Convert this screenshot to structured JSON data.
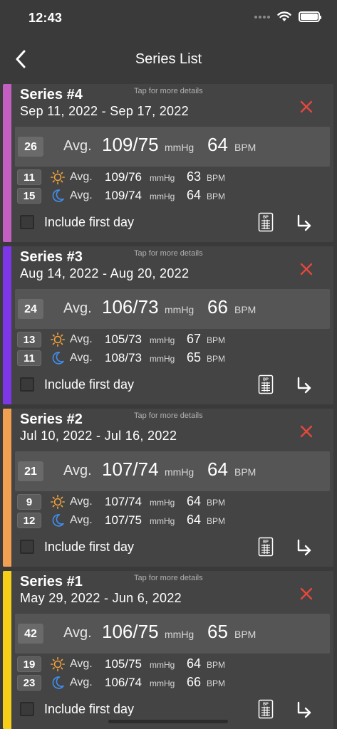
{
  "status": {
    "time": "12:43"
  },
  "nav": {
    "title": "Series List"
  },
  "common": {
    "hint": "Tap for more details",
    "avg_label": "Avg.",
    "unit_mmhg": "mmHg",
    "unit_bpm": "BPM",
    "include_first_day": "Include first day",
    "report_icon_text": "BP"
  },
  "colors": {
    "background": "#3a3a3a",
    "card": "#444444",
    "delete": "#e5473d",
    "sun": "#f2a23a",
    "moon": "#3f8ff0"
  },
  "series": [
    {
      "title": "Series #4",
      "dates": "Sep 11, 2022 - Sep 17, 2022",
      "stripe": "#c35fc2",
      "count": "26",
      "bp": "109/75",
      "pulse": "64",
      "day": {
        "count": "11",
        "bp": "109/76",
        "pulse": "63"
      },
      "night": {
        "count": "15",
        "bp": "109/74",
        "pulse": "64"
      }
    },
    {
      "title": "Series #3",
      "dates": "Aug 14, 2022 - Aug 20, 2022",
      "stripe": "#7d37e6",
      "count": "24",
      "bp": "106/73",
      "pulse": "66",
      "day": {
        "count": "13",
        "bp": "105/73",
        "pulse": "67"
      },
      "night": {
        "count": "11",
        "bp": "108/73",
        "pulse": "65"
      }
    },
    {
      "title": "Series #2",
      "dates": "Jul 10, 2022 - Jul 16, 2022",
      "stripe": "#f1a052",
      "count": "21",
      "bp": "107/74",
      "pulse": "64",
      "day": {
        "count": "9",
        "bp": "107/74",
        "pulse": "64"
      },
      "night": {
        "count": "12",
        "bp": "107/75",
        "pulse": "64"
      }
    },
    {
      "title": "Series #1",
      "dates": "May 29, 2022 - Jun 6, 2022",
      "stripe": "#f5cf18",
      "count": "42",
      "bp": "106/75",
      "pulse": "65",
      "day": {
        "count": "19",
        "bp": "105/75",
        "pulse": "64"
      },
      "night": {
        "count": "23",
        "bp": "106/74",
        "pulse": "66"
      }
    }
  ]
}
